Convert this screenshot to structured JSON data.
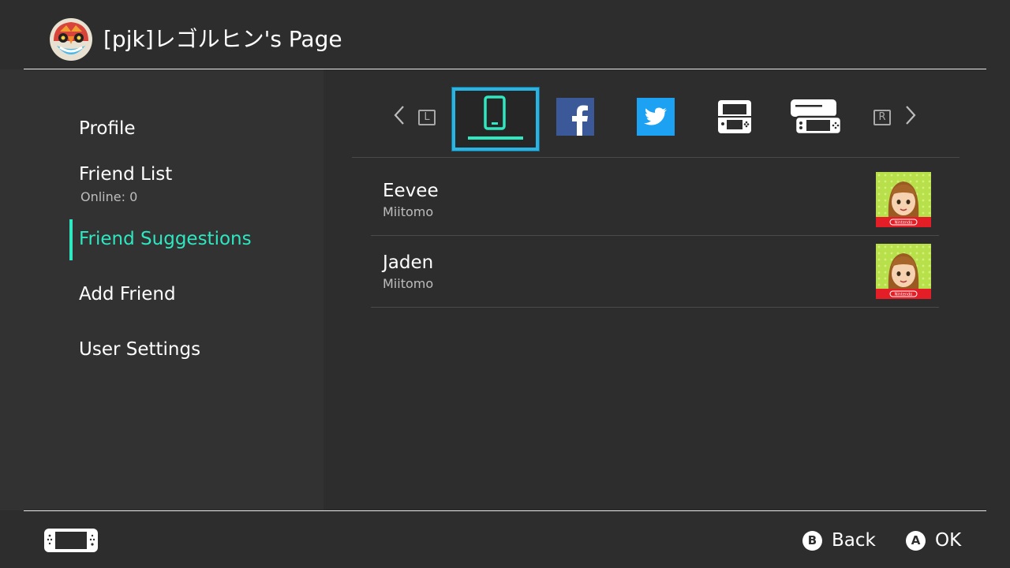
{
  "header": {
    "title": "[pjk]レゴルヒン's Page"
  },
  "sidebar": {
    "items": [
      {
        "label": "Profile"
      },
      {
        "label": "Friend List",
        "sub": "Online: 0"
      },
      {
        "label": "Friend Suggestions",
        "active": true
      },
      {
        "label": "Add Friend"
      },
      {
        "label": "User Settings"
      }
    ]
  },
  "tabs": {
    "prev_button": "L",
    "next_button": "R",
    "items": [
      {
        "icon": "smart-device-icon",
        "selected": true
      },
      {
        "icon": "facebook-icon",
        "color": "#3b5998"
      },
      {
        "icon": "twitter-icon",
        "color": "#1da1f2"
      },
      {
        "icon": "3ds-icon"
      },
      {
        "icon": "wii-u-icon"
      }
    ]
  },
  "suggestions": [
    {
      "name": "Eevee",
      "source": "Miitomo",
      "badge": "Nintendo"
    },
    {
      "name": "Jaden",
      "source": "Miitomo",
      "badge": "Nintendo"
    }
  ],
  "footer": {
    "back": {
      "key": "B",
      "label": "Back"
    },
    "ok": {
      "key": "A",
      "label": "OK"
    }
  },
  "colors": {
    "accent": "#2de8c0",
    "selection": "#2bb3e2",
    "background": "#2d2d2d"
  }
}
